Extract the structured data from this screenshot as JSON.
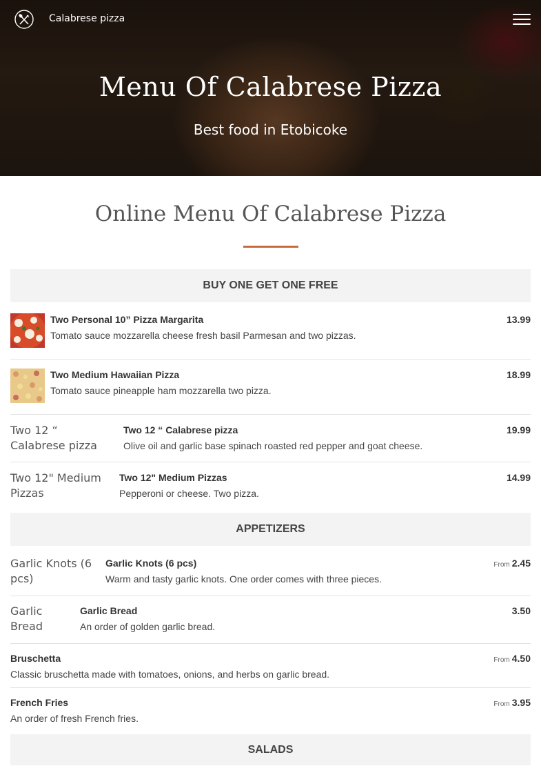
{
  "header": {
    "brand": "Calabrese pizza",
    "logo_icon": "crossed-utensils-icon",
    "menu_icon": "hamburger-menu-icon"
  },
  "hero": {
    "title": "Menu Of Calabrese Pizza",
    "subtitle": "Best food in Etobicoke"
  },
  "menu": {
    "title": "Online Menu Of Calabrese Pizza",
    "accent_color": "#c86b3c",
    "categories": [
      {
        "name": "BUY ONE GET ONE FREE",
        "items": [
          {
            "name": "Two Personal 10” Pizza Margarita",
            "desc": "Tomato sauce mozzarella cheese fresh basil Parmesan and two pizzas.",
            "price": "13.99"
          },
          {
            "name": "Two Medium Hawaiian Pizza",
            "desc": "Tomato sauce pineapple ham mozzarella two pizza.",
            "price": "18.99"
          },
          {
            "name": "Two 12 “ Calabrese pizza",
            "desc": "Olive oil and garlic base spinach roasted red pepper and goat cheese.",
            "price": "19.99",
            "img_alt": "Two 12 “ Calabrese pizza"
          },
          {
            "name": "Two 12\" Medium Pizzas",
            "desc": "Pepperoni or cheese. Two pizza.",
            "price": "14.99",
            "img_alt": "Two 12\" Medium Pizzas"
          }
        ]
      },
      {
        "name": "APPETIZERS",
        "items": [
          {
            "name": "Garlic Knots (6 pcs)",
            "desc": "Warm and tasty garlic knots. One order comes with three pieces.",
            "price": "2.45",
            "price_prefix": "From",
            "img_alt": "Garlic Knots (6 pcs)"
          },
          {
            "name": "Garlic Bread",
            "desc": "An order of golden garlic bread.",
            "price": "3.50",
            "img_alt": "Garlic Bread"
          },
          {
            "name": "Bruschetta",
            "desc": "Classic bruschetta made with tomatoes, onions, and herbs on garlic bread.",
            "price": "4.50",
            "price_prefix": "From"
          },
          {
            "name": "French Fries",
            "desc": "An order of fresh French fries.",
            "price": "3.95",
            "price_prefix": "From"
          }
        ]
      },
      {
        "name": "SALADS",
        "items": []
      }
    ]
  }
}
